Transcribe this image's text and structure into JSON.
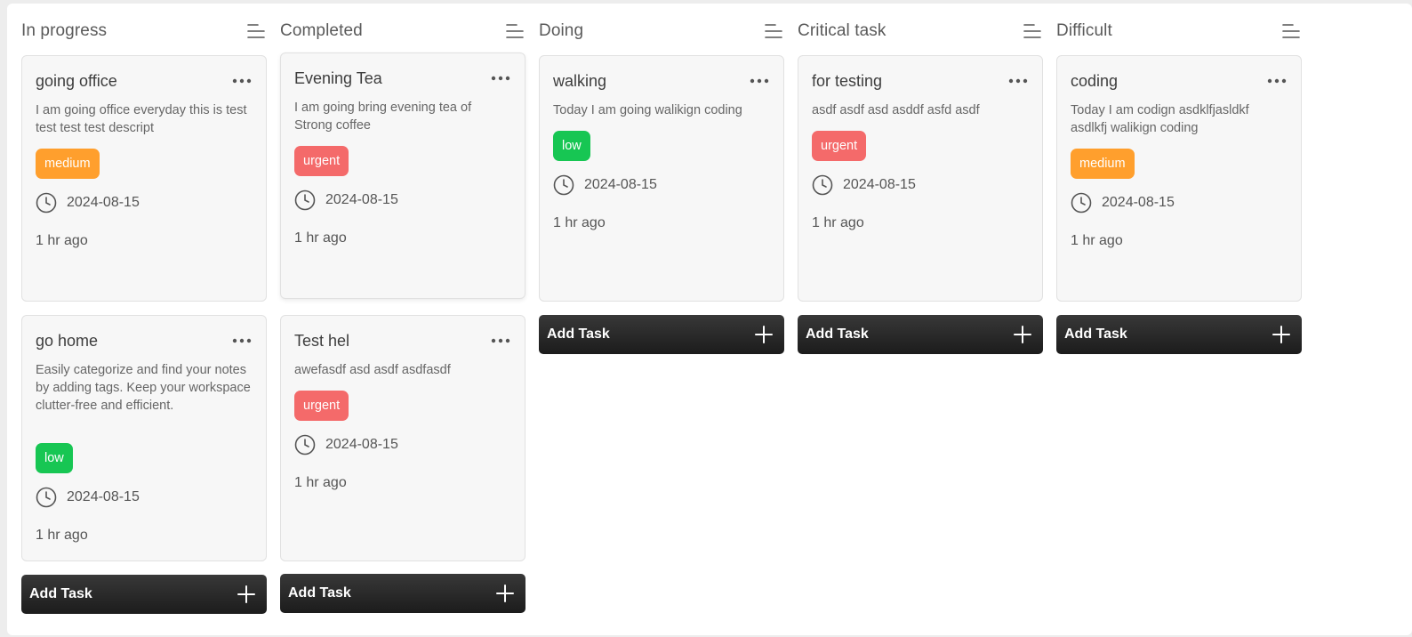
{
  "colors": {
    "medium": "#ff9f2d",
    "urgent": "#f46a6a",
    "low": "#17c653",
    "button": "#262626"
  },
  "add_task_label": "Add Task",
  "columns": [
    {
      "title": "In progress",
      "cards": [
        {
          "title": "going office",
          "description": "I am going office everyday this is test test test test descript",
          "priority": "medium",
          "date": "2024-08-15",
          "ago": "1 hr ago"
        },
        {
          "title": "go home",
          "description": "Easily categorize and find your notes by adding tags. Keep your workspace clutter-free and efficient.",
          "priority": "low",
          "date": "2024-08-15",
          "ago": "1 hr ago"
        }
      ]
    },
    {
      "title": "Completed",
      "cards": [
        {
          "title": "Evening Tea",
          "description": "I am going bring evening tea of Strong coffee",
          "priority": "urgent",
          "date": "2024-08-15",
          "ago": "1 hr ago"
        },
        {
          "title": "Test hel",
          "description": "awefasdf asd asdf asdfasdf",
          "priority": "urgent",
          "date": "2024-08-15",
          "ago": "1 hr ago"
        }
      ]
    },
    {
      "title": "Doing",
      "cards": [
        {
          "title": "walking",
          "description": "Today I am going walikign coding",
          "priority": "low",
          "date": "2024-08-15",
          "ago": "1 hr ago"
        }
      ]
    },
    {
      "title": "Critical task",
      "cards": [
        {
          "title": "for testing",
          "description": "asdf asdf asd asddf asfd asdf",
          "priority": "urgent",
          "date": "2024-08-15",
          "ago": "1 hr ago"
        }
      ]
    },
    {
      "title": "Difficult",
      "cards": [
        {
          "title": "coding",
          "description": "Today I am codign asdklfjasldkf asdlkfj walikign coding",
          "priority": "medium",
          "date": "2024-08-15",
          "ago": "1 hr ago"
        }
      ]
    }
  ]
}
